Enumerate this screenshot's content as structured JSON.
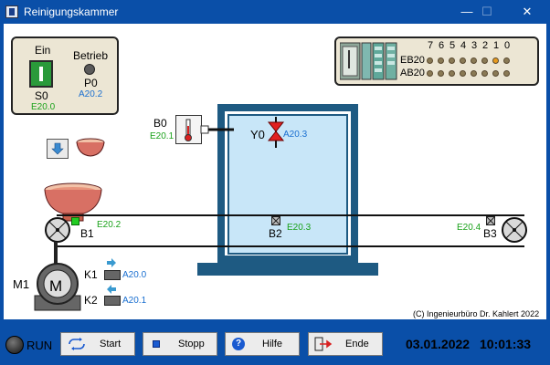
{
  "window": {
    "title": "Reinigungskammer",
    "minimize": "—",
    "maximize": "☐",
    "close": "✕"
  },
  "switch_panel": {
    "ein_label": "Ein",
    "s0_label": "S0",
    "s0_addr": "E20.0",
    "betrieb_label": "Betrieb",
    "p0_label": "P0",
    "p0_addr": "A20.2"
  },
  "io_panel": {
    "bits": [
      "7",
      "6",
      "5",
      "4",
      "3",
      "2",
      "1",
      "0"
    ],
    "eb_label": "EB20",
    "ab_label": "AB20",
    "eb_active_bits": [
      "1"
    ],
    "colors": {
      "led_off": "#8a7a55",
      "led_on": "#e89b1e"
    }
  },
  "sensors": {
    "b0": {
      "label": "B0",
      "addr": "E20.1"
    },
    "b1": {
      "label": "B1",
      "addr": "E20.2"
    },
    "b2": {
      "label": "B2",
      "addr": "E20.3"
    },
    "b3": {
      "label": "B3",
      "addr": "E20.4"
    }
  },
  "valve": {
    "label": "Y0",
    "addr": "A20.3"
  },
  "motor": {
    "label": "M1",
    "symbol": "M"
  },
  "contactors": [
    {
      "label": "K1",
      "addr": "A20.0",
      "direction": "right"
    },
    {
      "label": "K2",
      "addr": "A20.1",
      "direction": "left"
    }
  ],
  "copyright": "(C) Ingenieurbüro Dr. Kahlert 2022",
  "status": {
    "run_label": "RUN"
  },
  "buttons": {
    "start": "Start",
    "stop": "Stopp",
    "help": "Hilfe",
    "end": "Ende"
  },
  "clock": {
    "date": "03.01.2022",
    "time": "10:01:33"
  },
  "colors": {
    "window_blue": "#0a4fa8",
    "chamber_blue": "#1e5a82",
    "water": "#c8e6f8",
    "sensor_green": "#1aa21a",
    "valve_red": "#e02020",
    "bowl": "#d87064"
  }
}
